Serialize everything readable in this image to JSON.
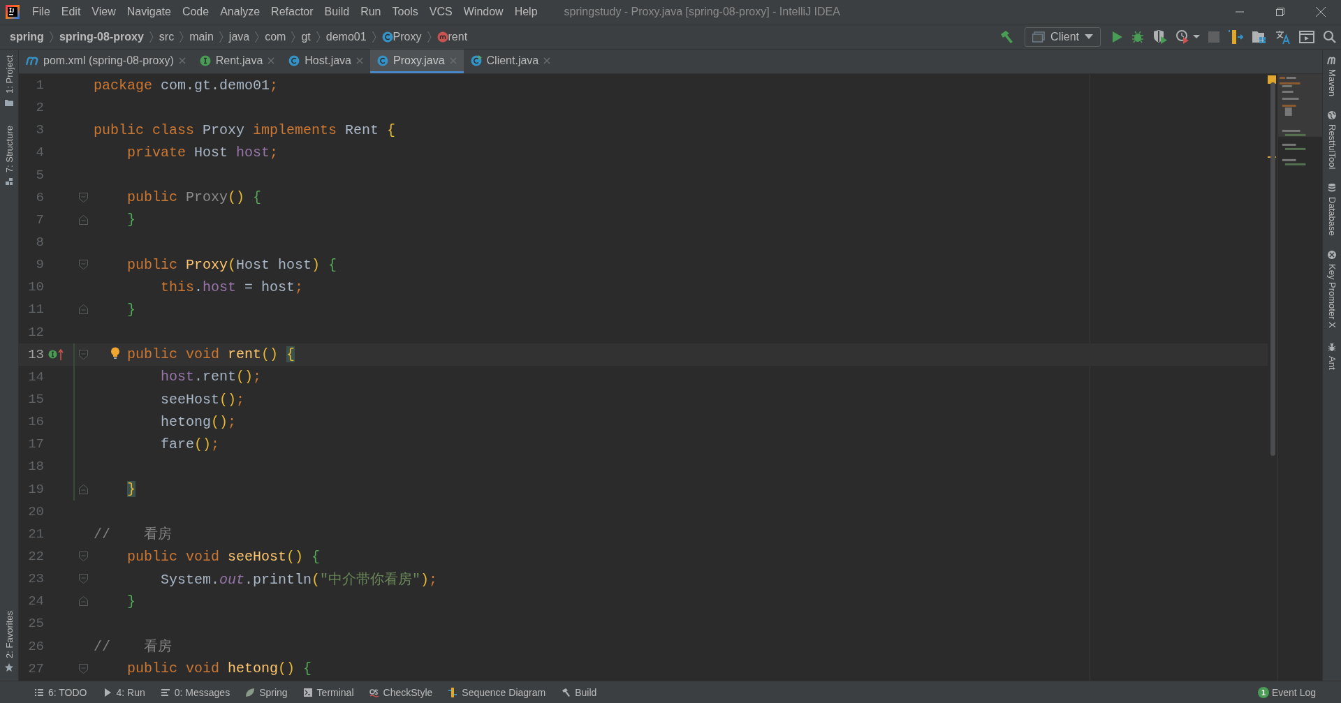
{
  "window": {
    "title": "springstudy - Proxy.java [spring-08-proxy] - IntelliJ IDEA"
  },
  "menu": [
    "File",
    "Edit",
    "View",
    "Navigate",
    "Code",
    "Analyze",
    "Refactor",
    "Build",
    "Run",
    "Tools",
    "VCS",
    "Window",
    "Help"
  ],
  "breadcrumbs": [
    {
      "label": "spring",
      "kind": "module"
    },
    {
      "label": "spring-08-proxy",
      "kind": "module"
    },
    {
      "label": "src",
      "kind": "folder"
    },
    {
      "label": "main",
      "kind": "folder"
    },
    {
      "label": "java",
      "kind": "folder"
    },
    {
      "label": "com",
      "kind": "folder"
    },
    {
      "label": "gt",
      "kind": "folder"
    },
    {
      "label": "demo01",
      "kind": "folder"
    },
    {
      "label": "Proxy",
      "kind": "class"
    },
    {
      "label": "rent",
      "kind": "method"
    }
  ],
  "run_config": "Client",
  "tabs": [
    {
      "label": "pom.xml (spring-08-proxy)",
      "kind": "maven",
      "selected": false
    },
    {
      "label": "Rent.java",
      "kind": "interface",
      "selected": false
    },
    {
      "label": "Host.java",
      "kind": "class",
      "selected": false
    },
    {
      "label": "Proxy.java",
      "kind": "class",
      "selected": true
    },
    {
      "label": "Client.java",
      "kind": "runnable",
      "selected": false
    }
  ],
  "left_tools": [
    {
      "label": "1: Project",
      "kind": "folder"
    },
    {
      "label": "7: Structure",
      "kind": "structure"
    }
  ],
  "left_bottom_tools": [
    {
      "label": "2: Favorites",
      "kind": "star"
    }
  ],
  "right_tools": [
    {
      "label": "Maven",
      "kind": "maven"
    },
    {
      "label": "RestfulTool",
      "kind": "globe"
    },
    {
      "label": "Database",
      "kind": "database"
    },
    {
      "label": "Key Promoter X",
      "kind": "key"
    },
    {
      "label": "Ant",
      "kind": "ant"
    }
  ],
  "editor": {
    "lines": [
      {
        "number": "1",
        "tokens": [
          {
            "t": "package",
            "kind": "kw"
          },
          {
            "t": " com.gt.demo01",
            "kind": "plain"
          },
          {
            "t": ";",
            "kind": "kw"
          }
        ]
      },
      {
        "number": "2"
      },
      {
        "number": "3",
        "tokens": [
          {
            "t": "public class",
            "kind": "kw"
          },
          {
            "t": " Proxy ",
            "kind": "plain"
          },
          {
            "t": "implements",
            "kind": "kw"
          },
          {
            "t": " Rent ",
            "kind": "plain"
          },
          {
            "t": "{",
            "kind": "b1"
          }
        ]
      },
      {
        "number": "4",
        "tokens": [
          {
            "t": "    private",
            "kind": "kw"
          },
          {
            "t": " Host ",
            "kind": "plain"
          },
          {
            "t": "host",
            "kind": "field"
          },
          {
            "t": ";",
            "kind": "kw"
          }
        ]
      },
      {
        "number": "5"
      },
      {
        "number": "6",
        "fold_start": true,
        "tokens": [
          {
            "t": "    public ",
            "kind": "kw"
          },
          {
            "t": "Proxy",
            "kind": "unused"
          },
          {
            "t": "() ",
            "kind": "b1"
          },
          {
            "t": "{",
            "kind": "b2"
          }
        ]
      },
      {
        "number": "7",
        "fold_end": true,
        "tokens": [
          {
            "t": "    }",
            "kind": "b2"
          }
        ]
      },
      {
        "number": "8"
      },
      {
        "number": "9",
        "fold_start": true,
        "tokens": [
          {
            "t": "    public ",
            "kind": "kw"
          },
          {
            "t": "Proxy",
            "kind": "fn"
          },
          {
            "t": "(",
            "kind": "b1"
          },
          {
            "t": "Host host",
            "kind": "plain"
          },
          {
            "t": ") ",
            "kind": "b1"
          },
          {
            "t": "{",
            "kind": "b2"
          }
        ]
      },
      {
        "number": "10",
        "tokens": [
          {
            "t": "        this",
            "kind": "kw"
          },
          {
            "t": ".",
            "kind": "plain"
          },
          {
            "t": "host",
            "kind": "field"
          },
          {
            "t": " = host",
            "kind": "plain"
          },
          {
            "t": ";",
            "kind": "kw"
          }
        ]
      },
      {
        "number": "11",
        "fold_end": true,
        "tokens": [
          {
            "t": "    }",
            "kind": "b2"
          }
        ]
      },
      {
        "number": "12"
      },
      {
        "number": "13",
        "fold_start": true,
        "current": true,
        "modified": true,
        "tokens": [
          {
            "t": "    public void ",
            "kind": "kw"
          },
          {
            "t": "rent",
            "kind": "fn"
          },
          {
            "t": "() ",
            "kind": "b1"
          },
          {
            "t": "{",
            "kind": "match"
          }
        ]
      },
      {
        "number": "14",
        "modified": true,
        "tokens": [
          {
            "t": "        host",
            "kind": "field"
          },
          {
            "t": ".rent",
            "kind": "plain"
          },
          {
            "t": "()",
            "kind": "b1"
          },
          {
            "t": ";",
            "kind": "kw"
          }
        ]
      },
      {
        "number": "15",
        "modified": true,
        "tokens": [
          {
            "t": "        seeHost",
            "kind": "plain"
          },
          {
            "t": "()",
            "kind": "b1"
          },
          {
            "t": ";",
            "kind": "kw"
          }
        ]
      },
      {
        "number": "16",
        "modified": true,
        "tokens": [
          {
            "t": "        hetong",
            "kind": "plain"
          },
          {
            "t": "()",
            "kind": "b1"
          },
          {
            "t": ";",
            "kind": "kw"
          }
        ]
      },
      {
        "number": "17",
        "modified": true,
        "tokens": [
          {
            "t": "        fare",
            "kind": "plain"
          },
          {
            "t": "()",
            "kind": "b1"
          },
          {
            "t": ";",
            "kind": "kw"
          }
        ]
      },
      {
        "number": "18",
        "modified": true
      },
      {
        "number": "19",
        "fold_end": true,
        "modified": true,
        "tokens": [
          {
            "t": "    }",
            "kind": "match"
          }
        ]
      },
      {
        "number": "20"
      },
      {
        "number": "21",
        "tokens": [
          {
            "t": "//    看房",
            "kind": "comment"
          }
        ]
      },
      {
        "number": "22",
        "fold_start": true,
        "tokens": [
          {
            "t": "    public void ",
            "kind": "kw"
          },
          {
            "t": "seeHost",
            "kind": "fn"
          },
          {
            "t": "() ",
            "kind": "b1"
          },
          {
            "t": "{",
            "kind": "b2"
          }
        ]
      },
      {
        "number": "23",
        "fold_start": true,
        "tokens": [
          {
            "t": "        System.",
            "kind": "plain"
          },
          {
            "t": "out",
            "kind": "static"
          },
          {
            "t": ".println",
            "kind": "plain"
          },
          {
            "t": "(",
            "kind": "b1"
          },
          {
            "t": "\"中介带你看房\"",
            "kind": "str"
          },
          {
            "t": ")",
            "kind": "b1"
          },
          {
            "t": ";",
            "kind": "kw"
          }
        ]
      },
      {
        "number": "24",
        "fold_end": true,
        "tokens": [
          {
            "t": "    }",
            "kind": "b2"
          }
        ]
      },
      {
        "number": "25"
      },
      {
        "number": "26",
        "tokens": [
          {
            "t": "//    看房",
            "kind": "comment"
          }
        ]
      },
      {
        "number": "27",
        "fold_start": true,
        "tokens": [
          {
            "t": "    public void ",
            "kind": "kw"
          },
          {
            "t": "hetong",
            "kind": "fn"
          },
          {
            "t": "() ",
            "kind": "b1"
          },
          {
            "t": "{",
            "kind": "b2"
          }
        ]
      }
    ]
  },
  "bottom_tools": [
    {
      "label": "6: TODO",
      "kind": "list"
    },
    {
      "label": "4: Run",
      "kind": "run"
    },
    {
      "label": "0: Messages",
      "kind": "messages"
    },
    {
      "label": "Spring",
      "kind": "leaf"
    },
    {
      "label": "Terminal",
      "kind": "terminal"
    },
    {
      "label": "CheckStyle",
      "kind": "checkstyle"
    },
    {
      "label": "Sequence Diagram",
      "kind": "sequence"
    },
    {
      "label": "Build",
      "kind": "hammer"
    }
  ],
  "event_log": {
    "label": "Event Log",
    "count": "1"
  }
}
